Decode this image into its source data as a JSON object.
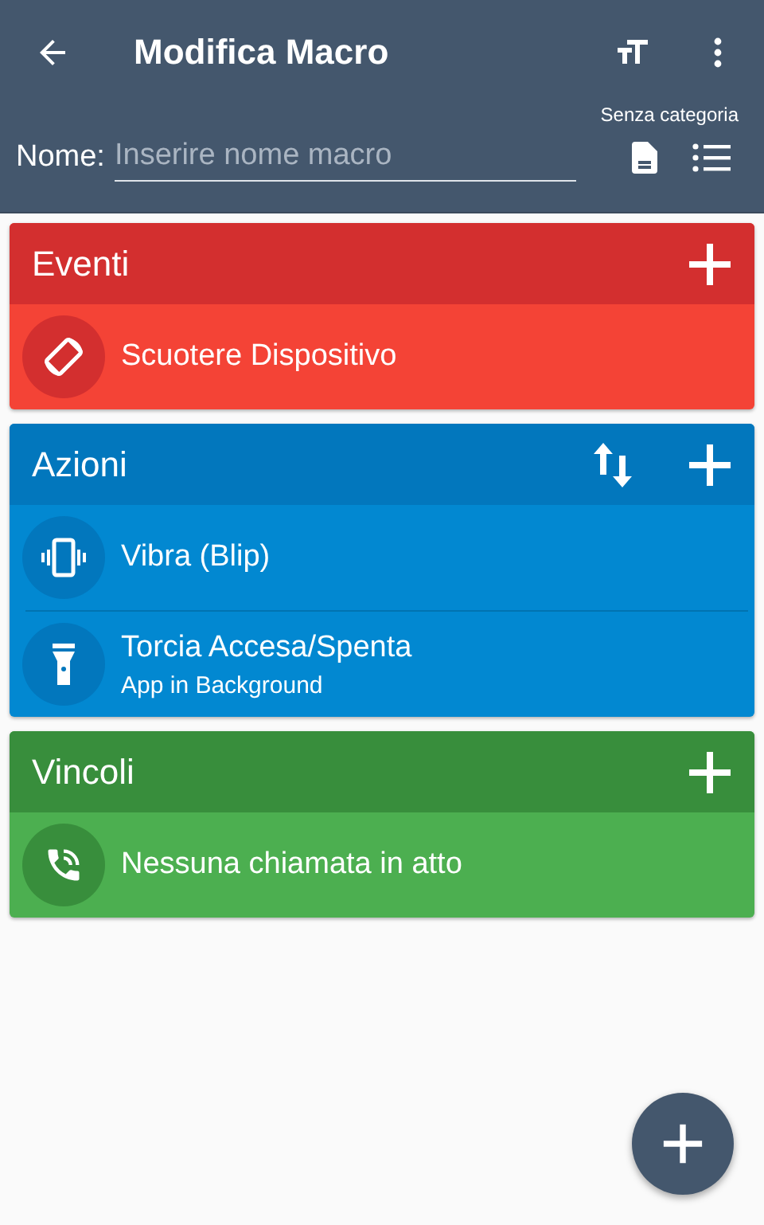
{
  "toolbar": {
    "title": "Modifica Macro"
  },
  "category": "Senza categoria",
  "name_field": {
    "label": "Nome:",
    "placeholder": "Inserire nome macro"
  },
  "sections": [
    {
      "title": "Eventi",
      "kind": "events",
      "sortable": false,
      "items": [
        {
          "kind": "rotate",
          "title": "Scuotere Dispositivo"
        }
      ]
    },
    {
      "title": "Azioni",
      "kind": "actions",
      "sortable": true,
      "items": [
        {
          "kind": "vibrate",
          "title": "Vibra (Blip)"
        },
        {
          "kind": "flashlight",
          "title": "Torcia Accesa/Spenta",
          "subtitle": "App in Background"
        }
      ]
    },
    {
      "title": "Vincoli",
      "kind": "constraints",
      "sortable": false,
      "items": [
        {
          "kind": "phone",
          "title": "Nessuna chiamata in atto"
        }
      ]
    }
  ]
}
